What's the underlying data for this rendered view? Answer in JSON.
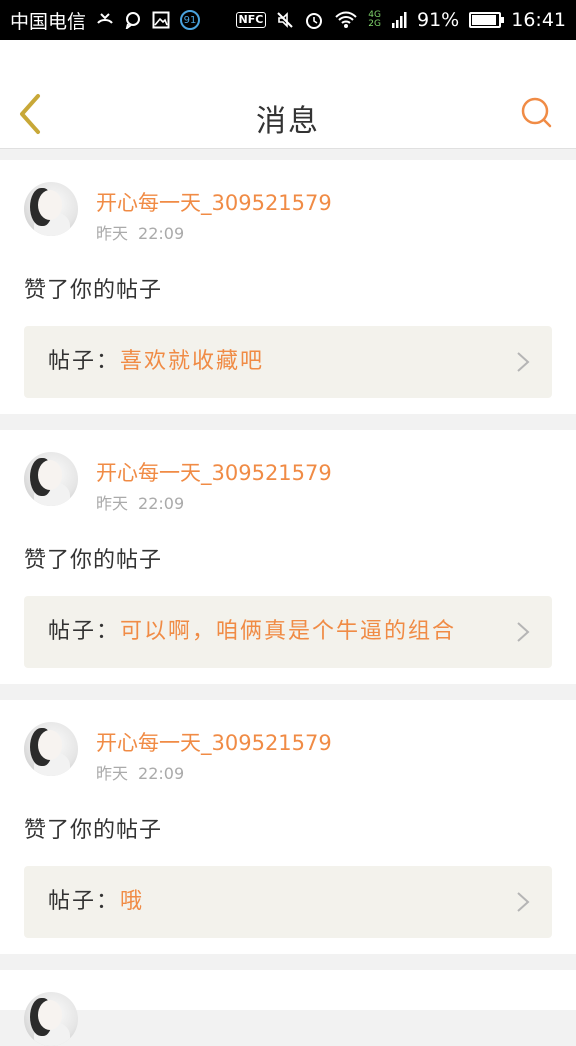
{
  "status_bar": {
    "carrier": "中国电信",
    "battery": "91%",
    "battery_level": 0.91,
    "time": "16:41",
    "nfc": "NFC",
    "badge": "91",
    "net_4g": "4G",
    "net_2g": "2G",
    "icons": [
      "missed-call-icon",
      "chat-bubble-icon",
      "image-icon",
      "badge-icon",
      "nfc-icon",
      "mute-icon",
      "alarm-icon",
      "wifi-icon",
      "signal-icon",
      "battery-icon"
    ]
  },
  "header": {
    "title": "消息",
    "back_icon": "chevron-left-icon",
    "search_icon": "search-icon"
  },
  "colors": {
    "accent": "#f08b45",
    "back_icon": "#c8a838",
    "post_background": "#f3f2ec"
  },
  "messages": [
    {
      "username": "开心每一天_309521579",
      "day": "昨天",
      "time": "22:09",
      "action": "赞了你的帖子",
      "post_label": "帖子：",
      "post_text": "喜欢就收藏吧"
    },
    {
      "username": "开心每一天_309521579",
      "day": "昨天",
      "time": "22:09",
      "action": "赞了你的帖子",
      "post_label": "帖子：",
      "post_text": "可以啊，咱俩真是个牛逼的组合"
    },
    {
      "username": "开心每一天_309521579",
      "day": "昨天",
      "time": "22:09",
      "action": "赞了你的帖子",
      "post_label": "帖子：",
      "post_text": "哦"
    }
  ]
}
